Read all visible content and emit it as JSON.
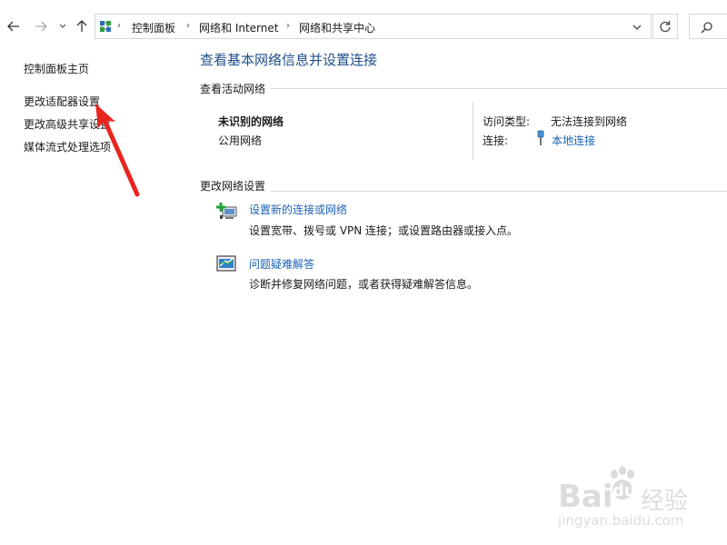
{
  "address_bar": {
    "breadcrumbs": [
      "控制面板",
      "网络和 Internet",
      "网络和共享中心"
    ]
  },
  "left_pane": {
    "links": [
      "控制面板主页",
      "更改适配器设置",
      "更改高级共享设置",
      "媒体流式处理选项"
    ]
  },
  "main": {
    "title": "查看基本网络信息并设置连接",
    "active_networks": {
      "heading": "查看活动网络",
      "network_name": "未识别的网络",
      "network_type": "公用网络",
      "access_type_label": "访问类型:",
      "access_type_value": "无法连接到网络",
      "connection_label": "连接:",
      "connection_value": "本地连接"
    },
    "change_settings": {
      "heading": "更改网络设置",
      "items": [
        {
          "title": "设置新的连接或网络",
          "desc": "设置宽带、拨号或 VPN 连接；或设置路由器或接入点。"
        },
        {
          "title": "问题疑难解答",
          "desc": "诊断并修复网络问题，或者获得疑难解答信息。"
        }
      ]
    }
  },
  "watermark": {
    "brand": "Bai",
    "brand2": "du",
    "cn": "经验",
    "url": "jingyan.baidu.com"
  },
  "colors": {
    "link": "#1b63b6",
    "title": "#1e4e8c",
    "annotation_arrow": "#e8251f"
  }
}
